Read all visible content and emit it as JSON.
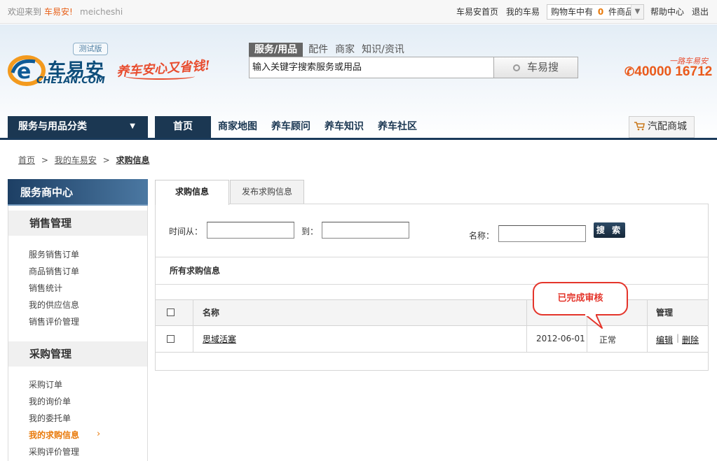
{
  "topbar": {
    "welcome": "欢迎来到",
    "site": "车易安!",
    "username": "meicheshi",
    "links": [
      "车易安首页",
      "我的车易"
    ],
    "cart_prefix": "购物车中有",
    "cart_count": "0",
    "cart_suffix": "件商品",
    "help": "帮助中心",
    "logout": "退出"
  },
  "header": {
    "logo_cn": "车易安",
    "logo_en": "CHE1AN.COM",
    "beta": "测试版",
    "slogan": "养车安心又省钱!",
    "hotline_slogan": "一路车易安",
    "hotline": "40000 16712",
    "search_tabs": [
      "服务/用品",
      "配件",
      "商家",
      "知识/资讯"
    ],
    "search_value": "输入关键字搜索服务或用品",
    "search_button": "车易搜"
  },
  "nav": {
    "category": "服务与用品分类",
    "items": [
      "首页",
      "商家地图",
      "养车顾问",
      "养车知识",
      "养车社区"
    ],
    "mall": "汽配商城"
  },
  "breadcrumb": [
    "首页",
    "我的车易安",
    "求购信息"
  ],
  "sidebar": {
    "title": "服务商中心",
    "sections": [
      {
        "title": "销售管理",
        "items": [
          "服务销售订单",
          "商品销售订单",
          "销售统计",
          "我的供应信息",
          "销售评价管理"
        ]
      },
      {
        "title": "采购管理",
        "items": [
          "采购订单",
          "我的询价单",
          "我的委托单",
          "我的求购信息",
          "采购评价管理"
        ]
      }
    ],
    "active": "我的求购信息"
  },
  "main": {
    "tabs": [
      "求购信息",
      "发布求购信息"
    ],
    "filter": {
      "time_from": "时间从：",
      "to": "到：",
      "name": "名称：",
      "search_button": "搜 索"
    },
    "section_title": "所有求购信息",
    "table": {
      "headers": [
        "名称",
        "",
        "",
        "管理"
      ],
      "rows": [
        {
          "name": "思域活塞",
          "date": "2012-06-01",
          "status": "正常",
          "edit": "编辑",
          "delete": "删除"
        }
      ]
    },
    "callout": "已完成审核"
  }
}
